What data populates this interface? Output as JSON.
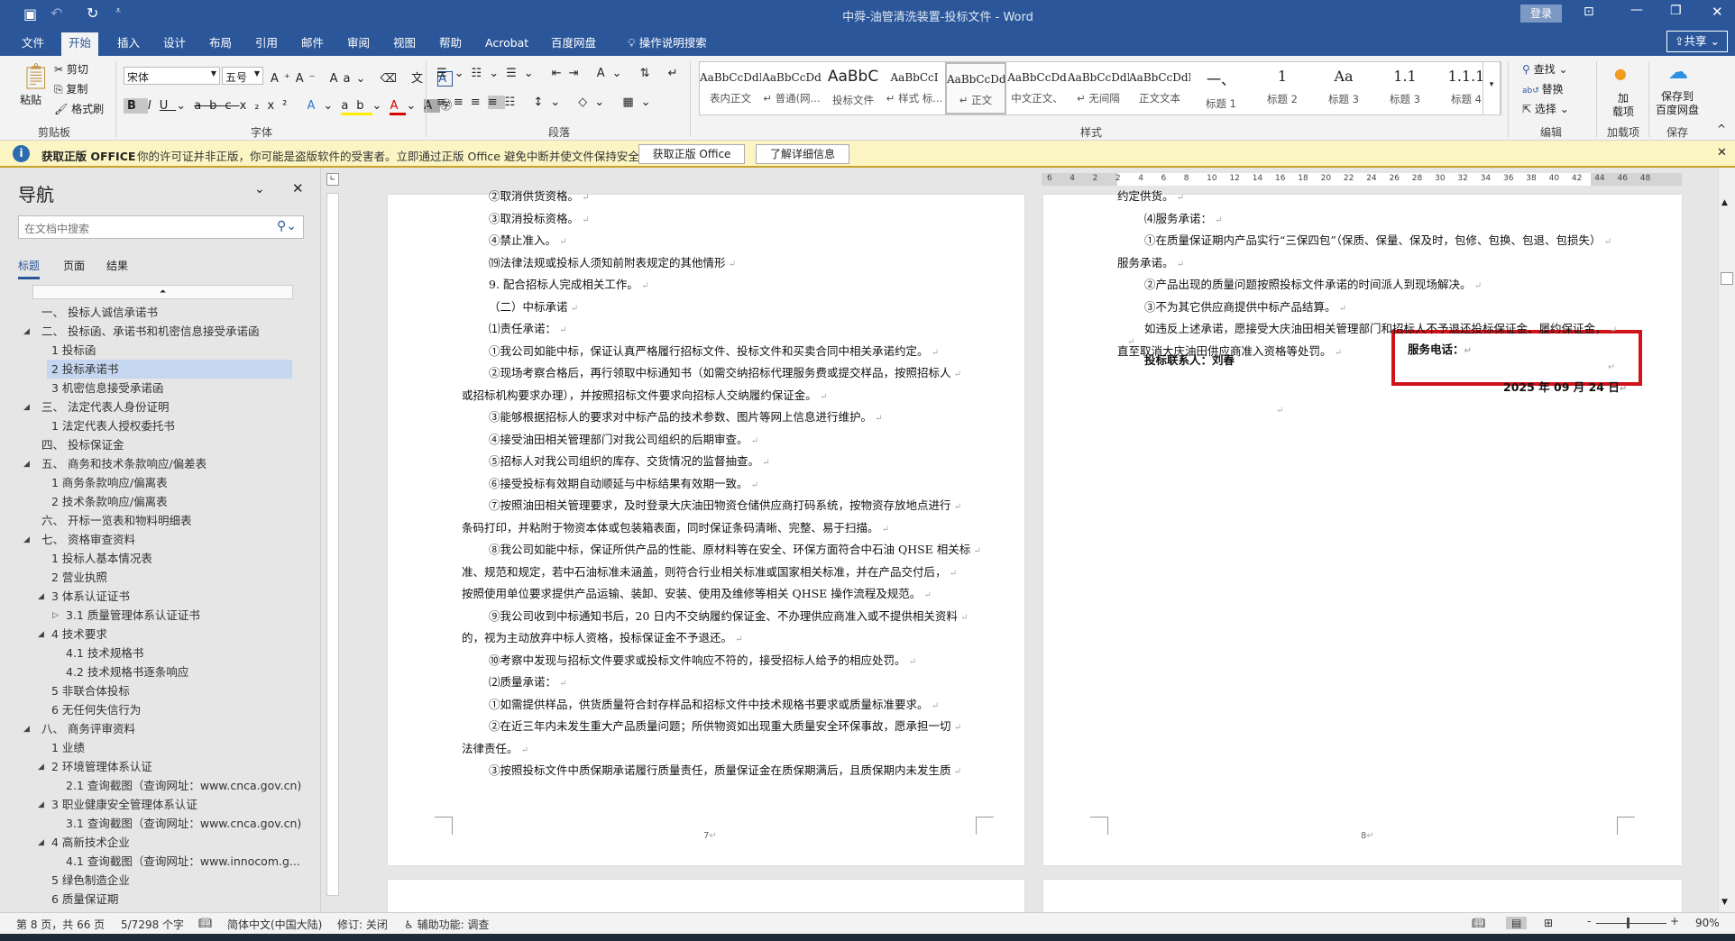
{
  "window": {
    "title": "中舜-油管清洗装置-投标文件  -  Word",
    "login": "登录",
    "share": "共享"
  },
  "tabs": [
    "文件",
    "开始",
    "插入",
    "设计",
    "布局",
    "引用",
    "邮件",
    "审阅",
    "视图",
    "帮助",
    "Acrobat",
    "百度网盘"
  ],
  "tell_me": "操作说明搜索",
  "ribbon": {
    "clipboard": {
      "paste": "粘贴",
      "cut": "剪切",
      "copy": "复制",
      "format_painter": "格式刷",
      "label": "剪贴板"
    },
    "font": {
      "name": "宋体",
      "size": "五号",
      "label": "字体"
    },
    "paragraph": {
      "label": "段落"
    },
    "styles": {
      "label": "样式",
      "items": [
        {
          "preview": "AaBbCcDdI",
          "name": "表内正文"
        },
        {
          "preview": "AaBbCcDd",
          "name": "↵ 普通(网..."
        },
        {
          "preview": "AaBbC",
          "name": "投标文件"
        },
        {
          "preview": "AaBbCcI",
          "name": "↵ 样式 标..."
        },
        {
          "preview": "AaBbCcDdI",
          "name": "↵ 正文"
        },
        {
          "preview": "AaBbCcDd",
          "name": "中文正文、"
        },
        {
          "preview": "AaBbCcDdI",
          "name": "↵ 无间隔"
        },
        {
          "preview": "AaBbCcDdI",
          "name": "正文文本"
        },
        {
          "preview": "一、",
          "name": "标题 1"
        },
        {
          "preview": "1",
          "name": "标题 2"
        },
        {
          "preview": "Aa",
          "name": "标题 3"
        },
        {
          "preview": "1.1",
          "name": "标题 3"
        },
        {
          "preview": "1.1.1",
          "name": "标题 4"
        }
      ]
    },
    "editing": {
      "find": "查找",
      "replace": "替换",
      "select": "选择",
      "label": "编辑"
    },
    "addins": {
      "btn": "加\n载项",
      "label": "加载项"
    },
    "save": {
      "btn": "保存到\n百度网盘",
      "label": "保存"
    }
  },
  "infobar": {
    "title": "获取正版 OFFICE",
    "message": "你的许可证并非正版，你可能是盗版软件的受害者。立即通过正版 Office 避免中断并使文件保持安全。",
    "btn_get": "获取正版 Office",
    "btn_more": "了解详细信息"
  },
  "nav": {
    "title": "导航",
    "search_placeholder": "在文档中搜索",
    "tabs": [
      "标题",
      "页面",
      "结果"
    ],
    "items": [
      {
        "t": "一、  投标人诚信承诺书",
        "lv": 0,
        "e": ""
      },
      {
        "t": "二、  投标函、承诺书和机密信息接受承诺函",
        "lv": 0,
        "e": "◢"
      },
      {
        "t": "1 投标函",
        "lv": 1,
        "e": ""
      },
      {
        "t": "2 投标承诺书",
        "lv": 1,
        "e": "",
        "hl": true
      },
      {
        "t": "3 机密信息接受承诺函",
        "lv": 1,
        "e": ""
      },
      {
        "t": "三、  法定代表人身份证明",
        "lv": 0,
        "e": "◢"
      },
      {
        "t": "1 法定代表人授权委托书",
        "lv": 1,
        "e": ""
      },
      {
        "t": "四、  投标保证金",
        "lv": 0,
        "e": ""
      },
      {
        "t": "五、  商务和技术条款响应/偏差表",
        "lv": 0,
        "e": "◢"
      },
      {
        "t": "1 商务条款响应/偏离表",
        "lv": 1,
        "e": ""
      },
      {
        "t": "2 技术条款响应/偏离表",
        "lv": 1,
        "e": ""
      },
      {
        "t": "六、  开标一览表和物料明细表",
        "lv": 0,
        "e": ""
      },
      {
        "t": "七、  资格审查资料",
        "lv": 0,
        "e": "◢"
      },
      {
        "t": "1 投标人基本情况表",
        "lv": 1,
        "e": ""
      },
      {
        "t": "2 营业执照",
        "lv": 1,
        "e": ""
      },
      {
        "t": "3 体系认证证书",
        "lv": 1,
        "e": "◢"
      },
      {
        "t": "3.1 质量管理体系认证证书",
        "lv": 2,
        "e": "▷"
      },
      {
        "t": "4 技术要求",
        "lv": 1,
        "e": "◢"
      },
      {
        "t": "4.1 技术规格书",
        "lv": 2,
        "e": ""
      },
      {
        "t": "4.2 技术规格书逐条响应",
        "lv": 2,
        "e": ""
      },
      {
        "t": "5 非联合体投标",
        "lv": 1,
        "e": ""
      },
      {
        "t": "6 无任何失信行为",
        "lv": 1,
        "e": ""
      },
      {
        "t": "八、  商务评审资料",
        "lv": 0,
        "e": "◢"
      },
      {
        "t": "1 业绩",
        "lv": 1,
        "e": ""
      },
      {
        "t": "2 环境管理体系认证",
        "lv": 1,
        "e": "◢"
      },
      {
        "t": "2.1 查询截图（查询网址：www.cnca.gov.cn)",
        "lv": 2,
        "e": ""
      },
      {
        "t": "3 职业健康安全管理体系认证",
        "lv": 1,
        "e": "◢"
      },
      {
        "t": "3.1 查询截图（查询网址：www.cnca.gov.cn)",
        "lv": 2,
        "e": ""
      },
      {
        "t": "4 高新技术企业",
        "lv": 1,
        "e": "◢"
      },
      {
        "t": "4.1 查询截图（查询网址：www.innocom.g...",
        "lv": 2,
        "e": ""
      },
      {
        "t": "5 绿色制造企业",
        "lv": 1,
        "e": ""
      },
      {
        "t": "6 质量保证期",
        "lv": 1,
        "e": ""
      }
    ]
  },
  "ruler": [
    "6",
    "4",
    "2",
    "2",
    "4",
    "6",
    "8",
    "10",
    "12",
    "14",
    "16",
    "18",
    "20",
    "22",
    "24",
    "26",
    "28",
    "30",
    "32",
    "34",
    "36",
    "38",
    "40",
    "42",
    "44",
    "46",
    "48"
  ],
  "page7": {
    "number": "7",
    "lines": [
      {
        "t": "②取消供货资格。",
        "i": 1
      },
      {
        "t": "③取消投标资格。",
        "i": 1
      },
      {
        "t": "④禁止准入。",
        "i": 1
      },
      {
        "t": "⒆法律法规或投标人须知前附表规定的其他情形",
        "i": 1
      },
      {
        "t": "9. 配合招标人完成相关工作。",
        "i": 1
      },
      {
        "t": "（二）中标承诺",
        "i": 1
      },
      {
        "t": "⑴责任承诺：",
        "i": 1
      },
      {
        "t": "①我公司如能中标，保证认真严格履行招标文件、投标文件和买卖合同中相关承诺约定。",
        "i": 1
      },
      {
        "t": "②现场考察合格后，再行领取中标通知书（如需交纳招标代理服务费或提交样品，按照招标人",
        "i": 1
      },
      {
        "t": "或招标机构要求办理），并按照招标文件要求向招标人交纳履约保证金。",
        "i": 0
      },
      {
        "t": "③能够根据招标人的要求对中标产品的技术参数、图片等网上信息进行维护。",
        "i": 1
      },
      {
        "t": "④接受油田相关管理部门对我公司组织的后期审查。",
        "i": 1
      },
      {
        "t": "⑤招标人对我公司组织的库存、交货情况的监督抽查。",
        "i": 1
      },
      {
        "t": "⑥接受投标有效期自动顺延与中标结果有效期一致。",
        "i": 1
      },
      {
        "t": "⑦按照油田相关管理要求，及时登录大庆油田物资仓储供应商打码系统，按物资存放地点进行",
        "i": 1
      },
      {
        "t": "条码打印，并粘附于物资本体或包装箱表面，同时保证条码清晰、完整、易于扫描。",
        "i": 0
      },
      {
        "t": "⑧我公司如能中标，保证所供产品的性能、原材料等在安全、环保方面符合中石油 QHSE 相关标",
        "i": 1
      },
      {
        "t": "准、规范和规定，若中石油标准未涵盖，则符合行业相关标准或国家相关标准，并在产品交付后，",
        "i": 0
      },
      {
        "t": "按照使用单位要求提供产品运输、装卸、安装、使用及维修等相关 QHSE 操作流程及规范。",
        "i": 0
      },
      {
        "t": "⑨我公司收到中标通知书后，20 日内不交纳履约保证金、不办理供应商准入或不提供相关资料",
        "i": 1
      },
      {
        "t": "的，视为主动放弃中标人资格，投标保证金不予退还。",
        "i": 0
      },
      {
        "t": "⑩考察中发现与招标文件要求或投标文件响应不符的，接受招标人给予的相应处罚。",
        "i": 1
      },
      {
        "t": "⑵质量承诺：",
        "i": 1
      },
      {
        "t": "①如需提供样品，供货质量符合封存样品和招标文件中技术规格书要求或质量标准要求。",
        "i": 1
      },
      {
        "t": "②在近三年内未发生重大产品质量问题；所供物资如出现重大质量安全环保事故，愿承担一切",
        "i": 1
      },
      {
        "t": "法律责任。",
        "i": 0
      },
      {
        "t": "③按照投标文件中质保期承诺履行质量责任，质量保证金在质保期满后，且质保期内未发生质",
        "i": 1
      }
    ]
  },
  "page8": {
    "number": "8",
    "lines": [
      {
        "t": "约定供货。",
        "i": 0
      },
      {
        "t": "⑷服务承诺：",
        "i": 1
      },
      {
        "t": "①在质量保证期内产品实行“三保四包”（保质、保量、保及时，包修、包换、包退、包损失）",
        "i": 1
      },
      {
        "t": "服务承诺。",
        "i": 0
      },
      {
        "t": "②产品出现的质量问题按照投标文件承诺的时间派人到现场解决。",
        "i": 1
      },
      {
        "t": "③不为其它供应商提供中标产品结算。",
        "i": 1
      },
      {
        "t": "如违反上述承诺，愿接受大庆油田相关管理部门和招标人不予退还投标保证金、履约保证金，",
        "i": 1
      },
      {
        "t": "直至取消大庆油田供应商准入资格等处罚。",
        "i": 0
      }
    ],
    "contact": "投标联系人：刘春",
    "phone": "服务电话：",
    "date": "2025 年 09 月 24 日"
  },
  "status": {
    "page": "第 8 页，共 66 页",
    "words": "5/7298 个字",
    "lang": "简体中文(中国大陆)",
    "track": "修订: 关闭",
    "access": "辅助功能: 调查",
    "zoom": "90%"
  },
  "colors": {
    "brand": "#2b579a",
    "highlight_box": "#d0121b",
    "infobar": "#fbf5c4"
  }
}
